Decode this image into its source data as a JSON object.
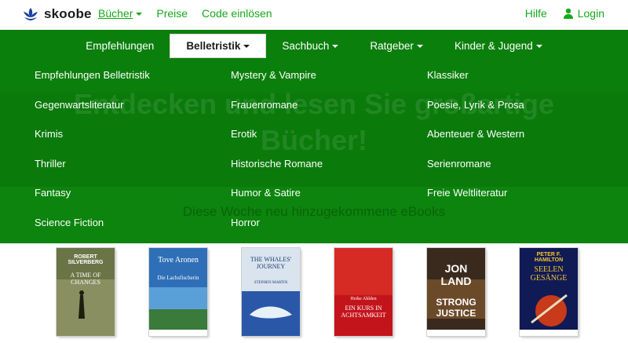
{
  "brand": {
    "name": "skoobe",
    "accent": "#17a81a",
    "green": "#0b7f0c"
  },
  "topnav": {
    "books_label": "Bücher",
    "prices_label": "Preise",
    "redeem_label": "Code einlösen",
    "help_label": "Hilfe",
    "login_label": "Login"
  },
  "hero": {
    "title": "Entdecken und lesen Sie großartige Bücher!",
    "subtitle": "Diese Woche neu hinzugekommene eBooks"
  },
  "categories": [
    {
      "label": "Empfehlungen",
      "dropdown": false
    },
    {
      "label": "Belletristik",
      "dropdown": true,
      "selected": true
    },
    {
      "label": "Sachbuch",
      "dropdown": true
    },
    {
      "label": "Ratgeber",
      "dropdown": true
    },
    {
      "label": "Kinder & Jugend",
      "dropdown": true
    }
  ],
  "menu": {
    "col1": [
      "Empfehlungen Belletristik",
      "Gegenwartsliteratur",
      "Krimis",
      "Thriller",
      "Fantasy",
      "Science Fiction"
    ],
    "col2": [
      "Mystery & Vampire",
      "Frauenromane",
      "Erotik",
      "Historische Romane",
      "Humor & Satire",
      "Horror"
    ],
    "col3": [
      "Klassiker",
      "Poesie, Lyrik & Prosa",
      "Abenteuer & Western",
      "Serienromane",
      "Freie Weltliteratur"
    ]
  },
  "books": [
    {
      "author": "ROBERT SILVERBERG",
      "title": "A TIME OF CHANGES",
      "color": "#5f6a3e"
    },
    {
      "author": "Tove Aronen",
      "title": "Die Lachsfischerin",
      "color": "#2f6fb7"
    },
    {
      "author": "STEPHEN MARTIN",
      "title": "THE WHALES' JOURNEY",
      "color": "#2a57a8"
    },
    {
      "author": "Heike Ahlden",
      "title": "EIN KURS IN ACHTSAMKEIT",
      "color": "#c4141b"
    },
    {
      "author": "JON LAND",
      "title": "STRONG JUSTICE",
      "color": "#3a2a1e"
    },
    {
      "author": "PETER F. HAMILTON",
      "title": "SEELEN GESÄNGE",
      "color": "#101a55"
    }
  ]
}
